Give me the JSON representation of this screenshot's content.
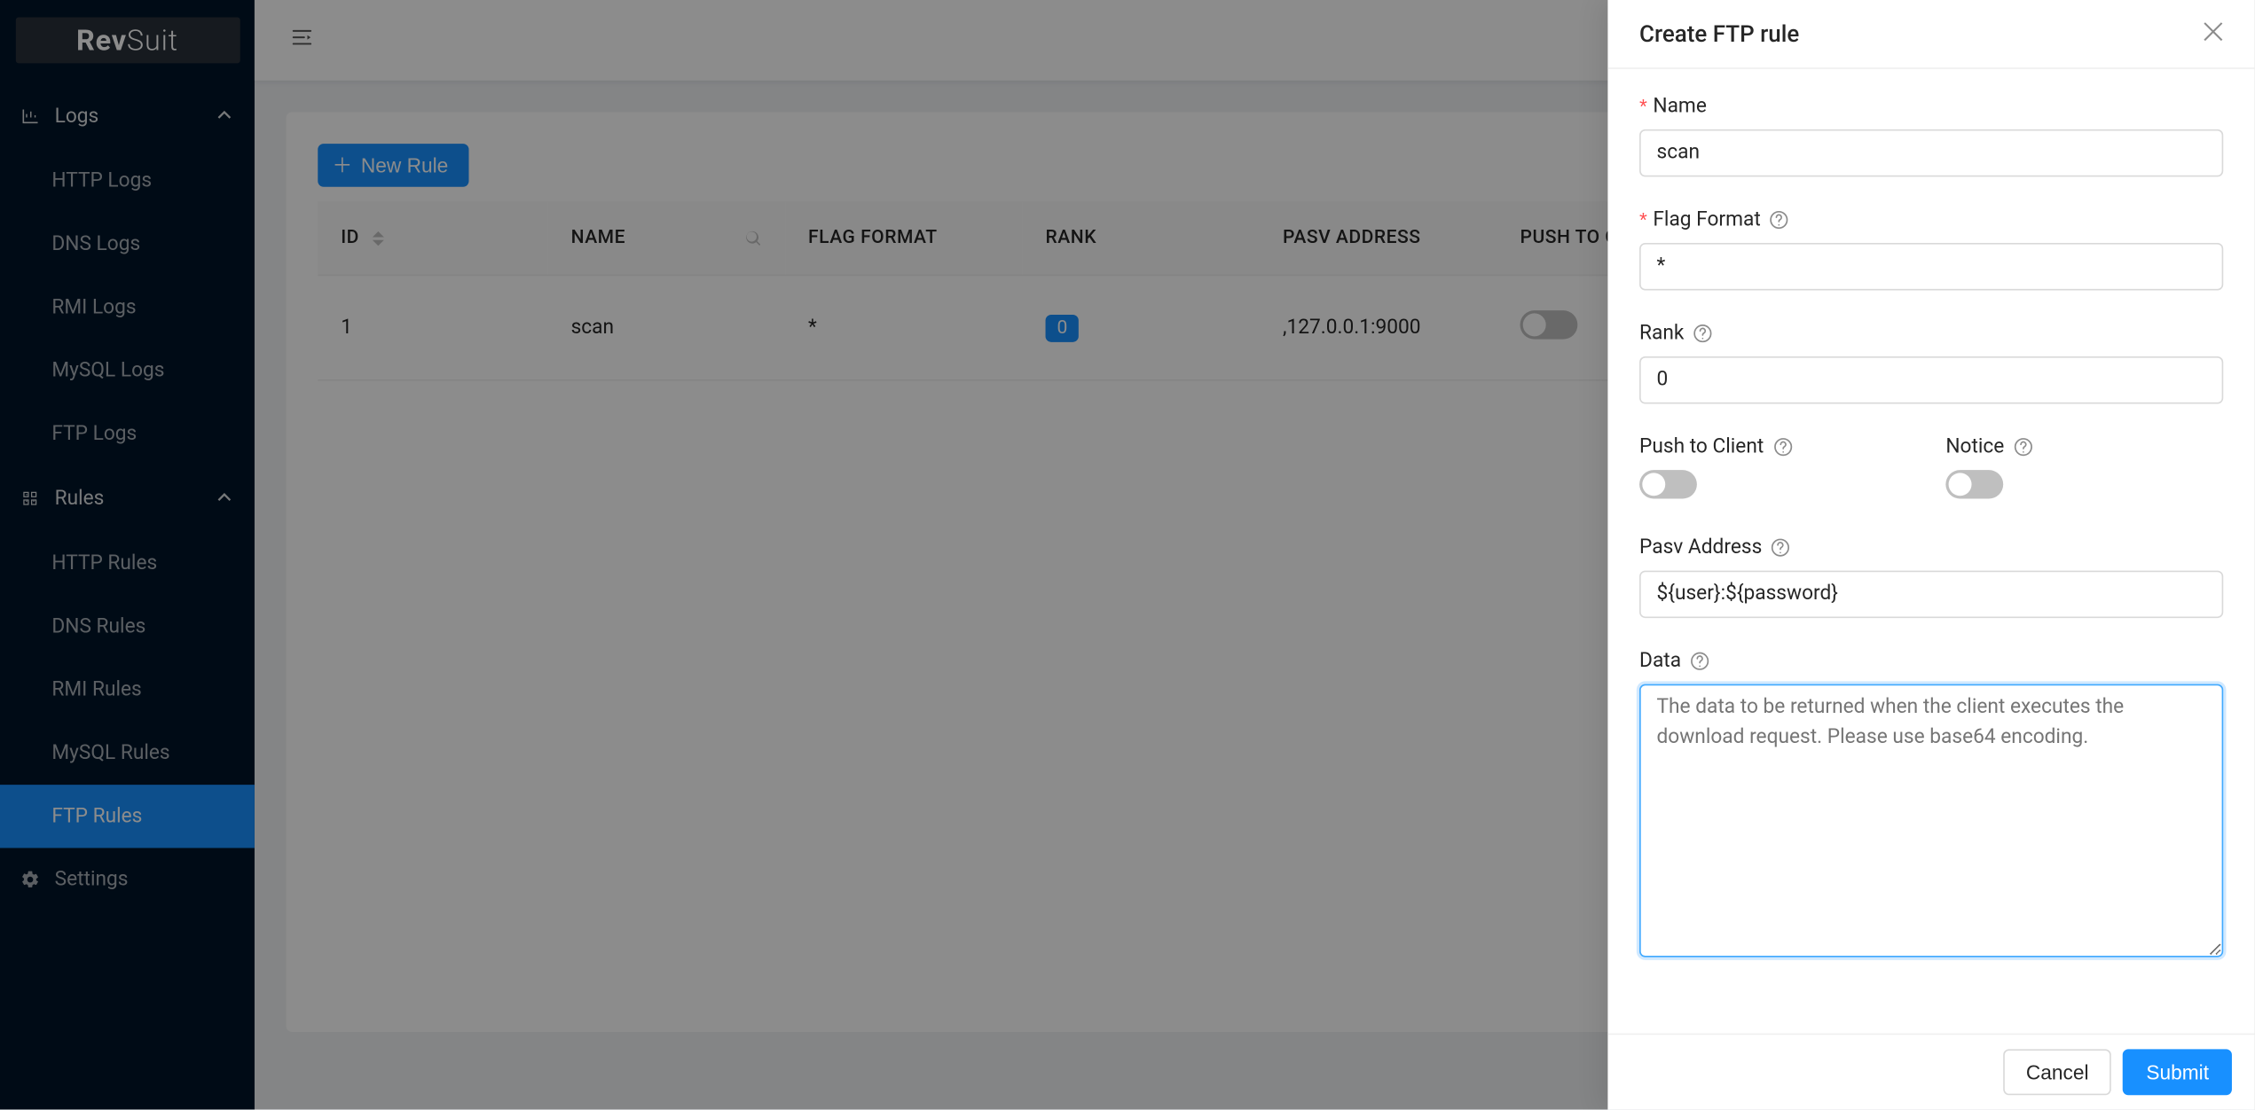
{
  "logo": {
    "bold": "Rev",
    "thin": "Suit"
  },
  "sidebar": {
    "logs": {
      "title": "Logs",
      "items": [
        "HTTP Logs",
        "DNS Logs",
        "RMI Logs",
        "MySQL Logs",
        "FTP Logs"
      ]
    },
    "rules": {
      "title": "Rules",
      "items": [
        "HTTP Rules",
        "DNS Rules",
        "RMI Rules",
        "MySQL Rules",
        "FTP Rules"
      ],
      "activeIndex": 4
    },
    "settings": "Settings"
  },
  "toolbar": {
    "new_rule": "New Rule"
  },
  "table": {
    "headers": {
      "id": "ID",
      "name": "NAME",
      "flag_format": "FLAG FORMAT",
      "rank": "RANK",
      "pasv_address": "PASV ADDRESS",
      "push_to_client": "PUSH TO CLIENT"
    },
    "rows": [
      {
        "id": "1",
        "name": "scan",
        "flag_format": "*",
        "rank": "0",
        "pasv_address": ",127.0.0.1:9000",
        "push_to_client": false
      }
    ]
  },
  "drawer": {
    "title": "Create FTP rule",
    "labels": {
      "name": "Name",
      "flag_format": "Flag Format",
      "rank": "Rank",
      "push_to_client": "Push to Client",
      "notice": "Notice",
      "pasv_address": "Pasv Address",
      "data": "Data"
    },
    "values": {
      "name": "scan",
      "flag_format": "*",
      "rank": "0",
      "pasv_address": "${user}:${password}",
      "data": ""
    },
    "placeholders": {
      "data": "The data to be returned when the client executes the download request. Please use base64 encoding."
    },
    "footer": {
      "cancel": "Cancel",
      "submit": "Submit"
    }
  }
}
